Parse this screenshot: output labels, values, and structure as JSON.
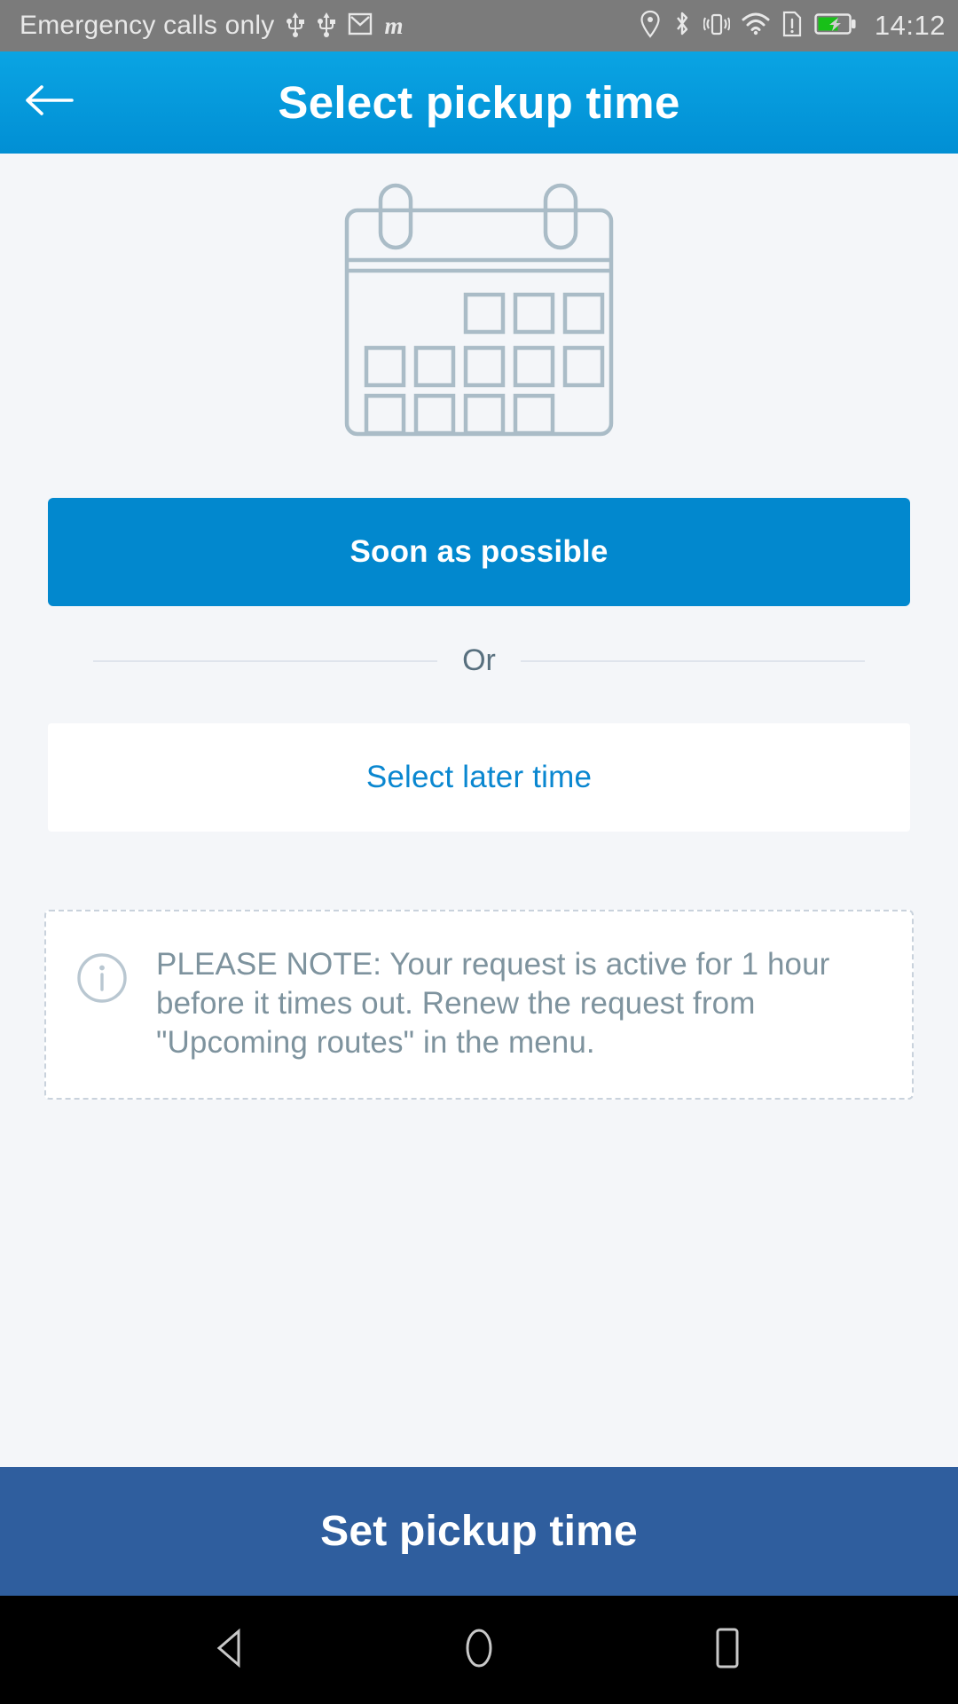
{
  "status_bar": {
    "carrier_text": "Emergency calls only",
    "time": "14:12",
    "icons": [
      "usb-icon",
      "usb-icon",
      "gmail-icon",
      "m-app-icon",
      "location-pin-icon",
      "bluetooth-icon",
      "vibrate-icon",
      "wifi-icon",
      "sim-alert-icon",
      "battery-charging-icon"
    ],
    "background_color": "#7b7b7b",
    "foreground_color": "#e8e8e8",
    "battery_fill_color": "#18c018"
  },
  "app_bar": {
    "title": "Select pickup time",
    "back_icon": "arrow-left-icon",
    "background_color": "#0a9fe0",
    "text_color": "#ffffff"
  },
  "illustration": {
    "name": "calendar-illustration",
    "stroke_color": "#aabcc7"
  },
  "main": {
    "primary_button": {
      "label": "Soon as possible",
      "background_color": "#0288ce",
      "text_color": "#ffffff"
    },
    "divider": {
      "label": "Or",
      "line_color": "#dfe4ec",
      "text_color": "#58707f"
    },
    "secondary_button": {
      "label": "Select later time",
      "background_color": "#ffffff",
      "text_color": "#0a87d0"
    },
    "note": {
      "icon": "info-circle-icon",
      "text": "PLEASE NOTE: Your request is active for 1 hour before it times out. Renew the request from \"Upcoming routes\" in the menu.",
      "border_color": "#c9d2dc",
      "text_color": "#7e939e"
    }
  },
  "bottom_action": {
    "label": "Set pickup time",
    "background_color": "#2f5e9e",
    "text_color": "#ffffff"
  },
  "nav_bar": {
    "background_color": "#000000",
    "buttons": [
      {
        "name": "android-back-icon"
      },
      {
        "name": "android-home-icon"
      },
      {
        "name": "android-recents-icon"
      }
    ]
  }
}
